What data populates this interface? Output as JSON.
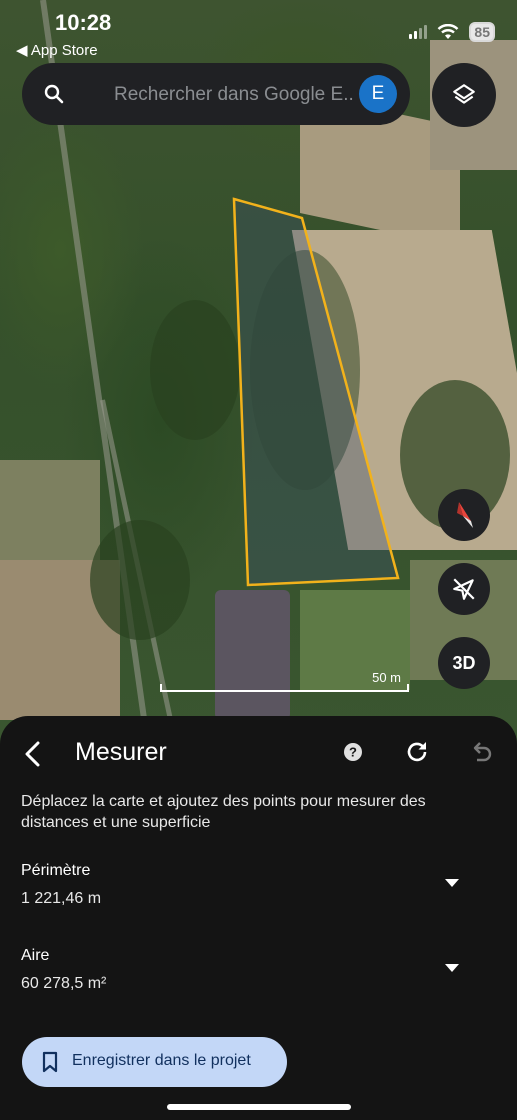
{
  "status_bar": {
    "time": "10:28",
    "back_app": "◀ App Store",
    "battery": "85"
  },
  "search": {
    "placeholder": "Rechercher dans Google E...",
    "avatar_letter": "E"
  },
  "map": {
    "scale_label": "50 m",
    "btn_3d": "3D"
  },
  "sheet": {
    "title": "Mesurer",
    "description": "Déplacez la carte et ajoutez des points pour mesurer des distances et une superficie",
    "perimeter": {
      "label": "Périmètre",
      "value": "1 221,46 m"
    },
    "area": {
      "label": "Aire",
      "value": "60 278,5 m²"
    },
    "save_label": "Enregistrer dans le projet"
  },
  "colors": {
    "measure_outline": "#f2b21b",
    "save_button_bg": "#c3d7f7",
    "avatar_bg": "#1a73c8"
  }
}
